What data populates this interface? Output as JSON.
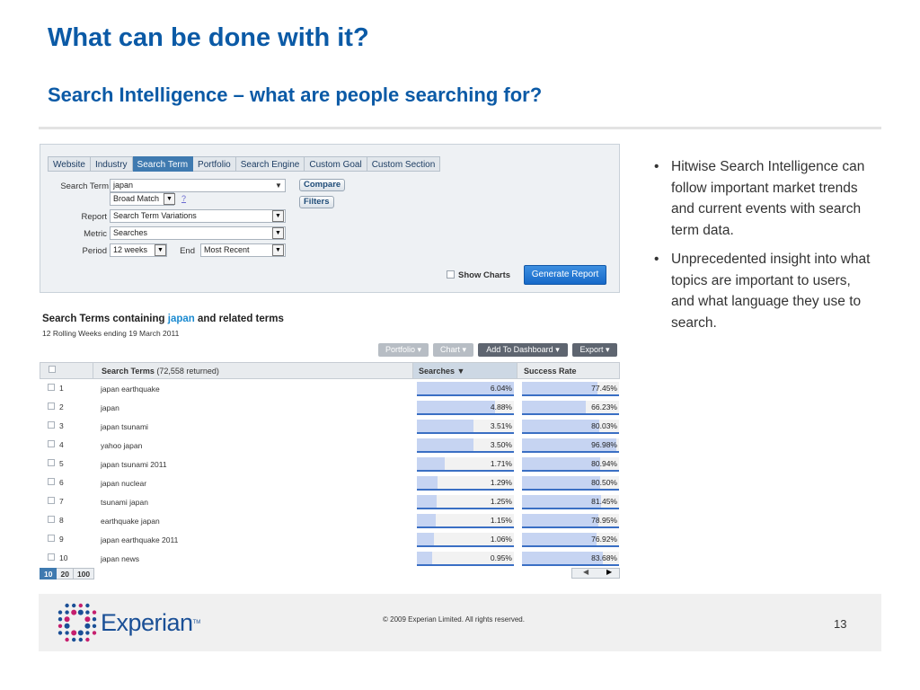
{
  "slide": {
    "title": "What can be done with it?",
    "subtitle": "Search Intelligence – what are people searching for?",
    "page_number": "13"
  },
  "form": {
    "tabs": [
      {
        "label": "Website",
        "active": false
      },
      {
        "label": "Industry",
        "active": false
      },
      {
        "label": "Search Term",
        "active": true
      },
      {
        "label": "Portfolio",
        "active": false
      },
      {
        "label": "Search Engine",
        "active": false
      },
      {
        "label": "Custom Goal",
        "active": false
      },
      {
        "label": "Custom Section",
        "active": false
      }
    ],
    "search_term_label": "Search Term",
    "search_term_value": "japan",
    "match_value": "Broad Match",
    "help_text": "?",
    "report_label": "Report",
    "report_value": "Search Term Variations",
    "metric_label": "Metric",
    "metric_value": "Searches",
    "period_label": "Period",
    "period_value": "12 weeks",
    "end_label": "End",
    "end_value": "Most Recent",
    "compare_label": "Compare",
    "filters_label": "Filters",
    "show_charts_label": "Show Charts",
    "generate_label": "Generate Report"
  },
  "report": {
    "title_prefix": "Search Terms containing",
    "title_term": "japan",
    "title_suffix": "and related terms",
    "subtitle": "12 Rolling Weeks ending 19 March 2011",
    "buttons": {
      "portfolio": "Portfolio",
      "chart": "Chart",
      "dashboard": "Add To Dashboard",
      "export": "Export"
    },
    "columns": {
      "terms": "Search Terms",
      "terms_count": "(72,558 returned)",
      "searches": "Searches",
      "success": "Success Rate"
    },
    "rows": [
      {
        "num": "1",
        "term": "japan earthquake",
        "searches": "6.04%",
        "success": "77.45%"
      },
      {
        "num": "2",
        "term": "japan",
        "searches": "4.88%",
        "success": "66.23%"
      },
      {
        "num": "3",
        "term": "japan tsunami",
        "searches": "3.51%",
        "success": "80.03%"
      },
      {
        "num": "4",
        "term": "yahoo japan",
        "searches": "3.50%",
        "success": "96.98%"
      },
      {
        "num": "5",
        "term": "japan tsunami 2011",
        "searches": "1.71%",
        "success": "80.94%"
      },
      {
        "num": "6",
        "term": "japan nuclear",
        "searches": "1.29%",
        "success": "80.50%"
      },
      {
        "num": "7",
        "term": "tsunami japan",
        "searches": "1.25%",
        "success": "81.45%"
      },
      {
        "num": "8",
        "term": "earthquake japan",
        "searches": "1.15%",
        "success": "78.95%"
      },
      {
        "num": "9",
        "term": "japan earthquake 2011",
        "searches": "1.06%",
        "success": "76.92%"
      },
      {
        "num": "10",
        "term": "japan news",
        "searches": "0.95%",
        "success": "83.68%"
      }
    ],
    "page_sizes": [
      {
        "label": "10",
        "active": true
      },
      {
        "label": "20",
        "active": false
      },
      {
        "label": "100",
        "active": false
      }
    ]
  },
  "bullets": [
    "Hitwise Search Intelligence can follow important market trends and current events with search term data.",
    "Unprecedented insight into what topics are important to users, and what language they use to search."
  ],
  "footer": {
    "brand": "Experian",
    "trademark": "TM",
    "copyright": "© 2009 Experian Limited.  All rights reserved."
  },
  "colors": {
    "title_blue": "#0b5aa6",
    "tab_active": "#3f7ab0",
    "generate_button": "#1669c9",
    "bar_fill": "#c6d4f2",
    "bar_base": "#3a6fc4",
    "brand_blue": "#1a4f96",
    "brand_magenta": "#c51f6e"
  },
  "icons": {
    "dropdown": "triangle-down",
    "sort": "triangle-down",
    "scroll_left": "triangle-left",
    "scroll_right": "triangle-right",
    "logo": "dot-grid-logo"
  }
}
